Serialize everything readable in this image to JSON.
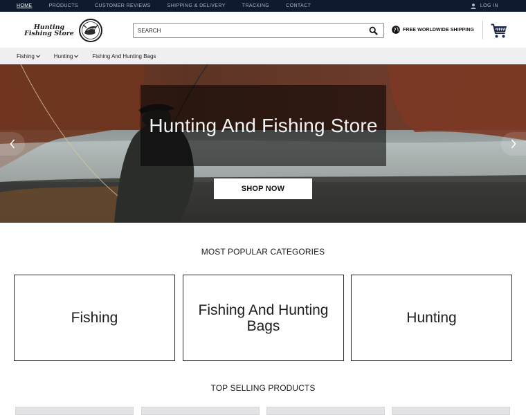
{
  "topbar": {
    "nav": [
      "HOME",
      "PRODUCTS",
      "CUSTOMER REVIEWS",
      "SHIPPING & DELIVERY",
      "TRACKING",
      "CONTACT"
    ],
    "login_label": "LOG IN"
  },
  "header": {
    "logo_text": "Hunting Fishing Store",
    "search_placeholder": "SEARCH",
    "shipping_label": "FREE WORLDWIDE SHIPPING"
  },
  "catnav": {
    "items": [
      "Fishing",
      "Hunting",
      "Fishing And Hunting Bags"
    ]
  },
  "hero": {
    "caption": "Hunting And Fishing Store",
    "button_label": "SHOP NOW"
  },
  "categories": {
    "title": "MOST POPULAR CATEGORIES",
    "items": [
      "Fishing",
      "Fishing And Hunting Bags",
      "Hunting"
    ]
  },
  "products": {
    "title": "TOP SELLING PRODUCTS"
  },
  "colors": {
    "topbar_bg": "#0f1a2e",
    "catnav_bg": "#efeff2",
    "search_border": "#8a8a8a"
  },
  "icons": {
    "login": "user-icon",
    "search": "magnifier-icon",
    "shipping": "globe-icon",
    "cart": "shopping-cart-icon",
    "dropdown": "chevron-down-icon",
    "prev": "chevron-left-icon",
    "next": "chevron-right-icon"
  }
}
